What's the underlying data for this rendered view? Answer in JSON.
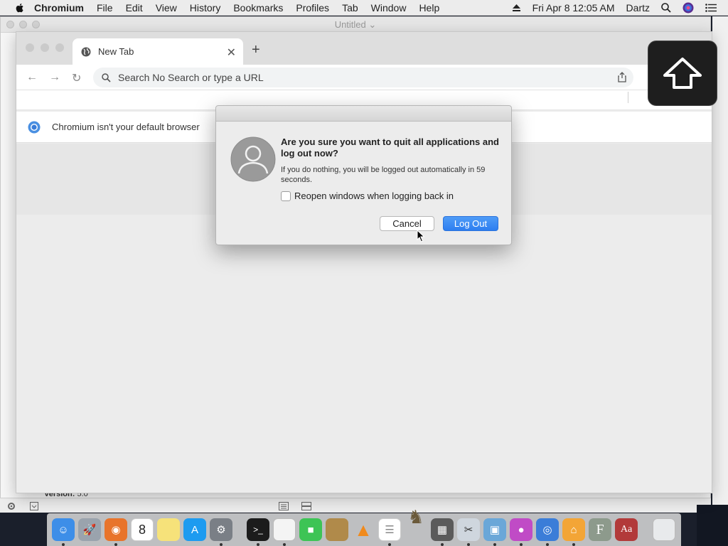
{
  "menubar": {
    "app_name": "Chromium",
    "items": [
      "File",
      "Edit",
      "View",
      "History",
      "Bookmarks",
      "Profiles",
      "Tab",
      "Window",
      "Help"
    ],
    "datetime": "Fri Apr 8  12:05 AM",
    "user": "Dartz"
  },
  "background_window": {
    "title": "Untitled",
    "version_label": "Version:",
    "version_value": "5.0"
  },
  "browser": {
    "tab_title": "New Tab",
    "omnibox_placeholder": "Search No Search or type a URL",
    "infobar_message": "Chromium isn't your default browser"
  },
  "dialog": {
    "heading": "Are you sure you want to quit all applications and log out now?",
    "subtext": "If you do nothing, you will be logged out automatically in 59 seconds.",
    "checkbox_label": "Reopen windows when logging back in",
    "checkbox_checked": false,
    "cancel_label": "Cancel",
    "logout_label": "Log Out",
    "accent_color": "#2e7ef0"
  },
  "dock": {
    "calendar_day": "8",
    "apps": [
      "finder-icon",
      "launchpad-icon",
      "firefox-icon",
      "calendar-icon",
      "notes-icon",
      "app-store-icon",
      "system-preferences-icon",
      "terminal-icon",
      "textedit-icon",
      "facetime-icon",
      "notebook-icon",
      "vlc-icon",
      "reminders-icon",
      "chess-icon",
      "calculator-icon",
      "xcode-tools-icon",
      "preview-icon",
      "growl-icon",
      "chromium-icon",
      "home-icon",
      "font-icon",
      "dictionary-icon",
      "trash-icon"
    ]
  }
}
